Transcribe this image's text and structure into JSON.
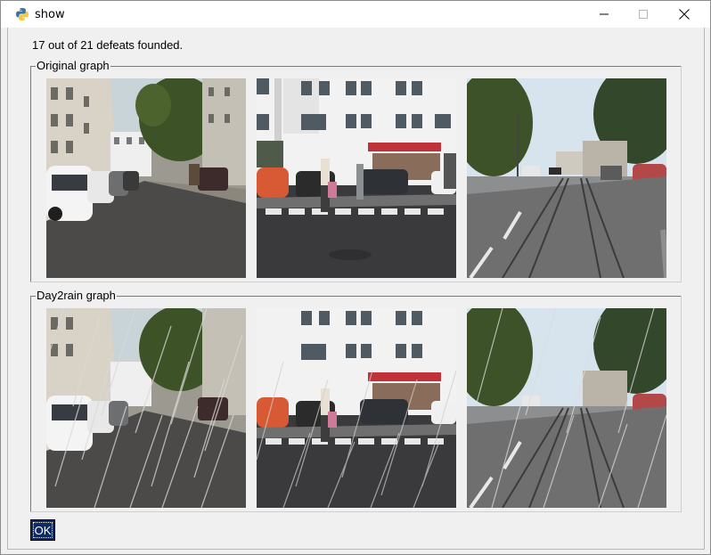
{
  "window": {
    "title": "show",
    "app_icon": "python-icon",
    "controls": {
      "minimize": "minimize-icon",
      "maximize": "maximize-icon",
      "close": "close-icon"
    }
  },
  "status_text": "17 out of 21 defeats founded.",
  "groups": {
    "original": {
      "label": "Original graph"
    },
    "day2rain": {
      "label": "Day2rain graph"
    }
  },
  "ok_label": "OK"
}
